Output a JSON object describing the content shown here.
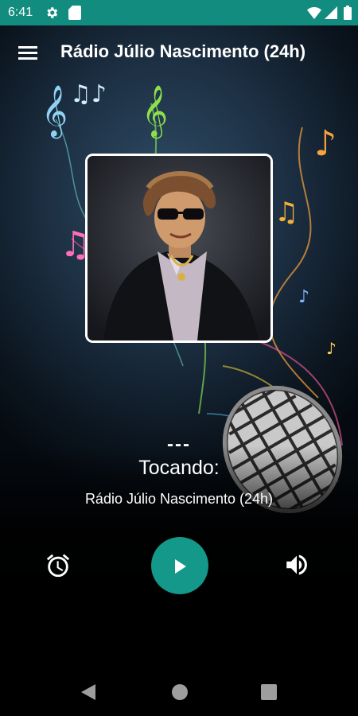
{
  "status_bar": {
    "time": "6:41",
    "icons": [
      "gear-icon",
      "sd-card-icon",
      "wifi-icon",
      "signal-icon",
      "battery-icon"
    ],
    "background_color": "#128c7e"
  },
  "app_bar": {
    "menu_icon": "hamburger-menu-icon",
    "title": "Rádio Júlio Nascimento (24h)"
  },
  "now_playing": {
    "track": "---",
    "label": "Tocando:",
    "station": "Rádio Júlio Nascimento (24h)"
  },
  "controls": {
    "alarm_icon": "alarm-clock-icon",
    "play_icon": "play-icon",
    "volume_icon": "volume-icon",
    "play_button_color": "#13988a"
  },
  "nav_bar": {
    "icons": [
      "back-icon",
      "home-icon",
      "recents-icon"
    ]
  }
}
